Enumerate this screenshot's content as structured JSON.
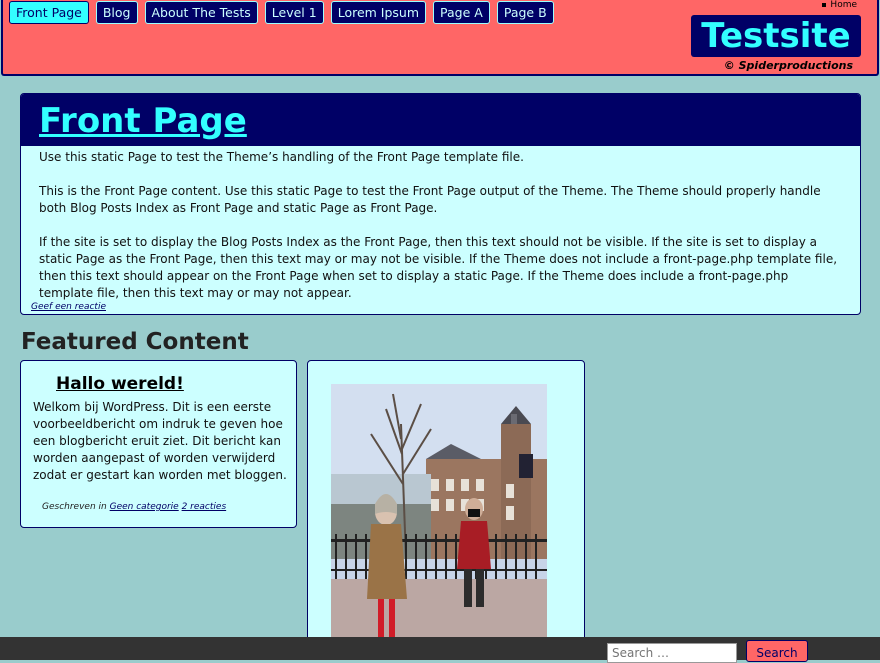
{
  "nav": {
    "items": [
      "Front Page",
      "Blog",
      "About The Tests",
      "Level 1",
      "Lorem Ipsum",
      "Page A",
      "Page B"
    ]
  },
  "top_links": {
    "home": "Home"
  },
  "site": {
    "title": "Testsite",
    "tagline": "© Spiderproductions"
  },
  "article": {
    "title": "Front Page",
    "paragraphs": [
      "Use this static Page to test the Theme’s handling of the Front Page template file.",
      "This is the Front Page content. Use this static Page to test the Front Page output of the Theme. The Theme should properly handle both Blog Posts Index as Front Page and static Page as Front Page.",
      "If the site is set to display the Blog Posts Index as the Front Page, then this text should not be visible. If the site is set to display a static Page as the Front Page, then this text may or may not be visible. If the Theme does not include a front-page.php template file, then this text should appear on the Front Page when set to display a static Page. If the Theme does include a front-page.php template file, then this text may or may not appear."
    ],
    "comment_link": "Geef een reactie"
  },
  "featured": {
    "heading": "Featured Content",
    "post": {
      "title": "Hallo wereld!",
      "excerpt": "Welkom bij WordPress. Dit is een eerste voorbeeldbericht om indruk te geven hoe een blogbericht eruit ziet. Dit bericht kan worden aangepast of worden verwijderd zodat er gestart kan worden met bloggen.",
      "meta_prefix": "Geschreven in",
      "category": "Geen categorie",
      "comments": "2 reacties"
    }
  },
  "footer": {
    "search_placeholder": "Search …",
    "search_button": "Search"
  },
  "colors": {
    "page_bg": "#99cccc",
    "header_bg": "#ff6666",
    "navy": "#000066",
    "cyan": "#33ffff",
    "panel_bg": "#ccffff",
    "footer_bg": "#333333"
  }
}
